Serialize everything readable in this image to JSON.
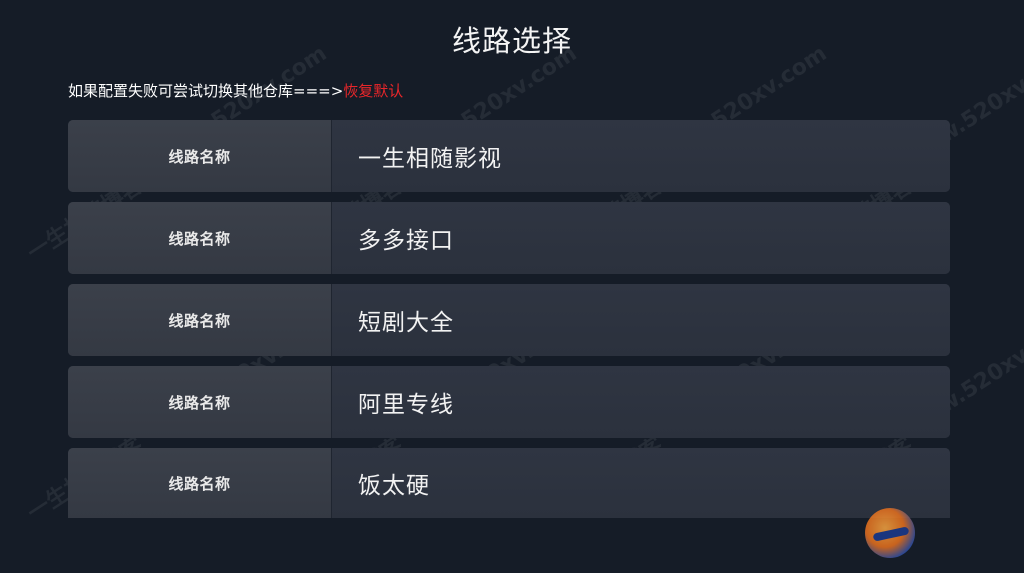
{
  "header": {
    "title": "线路选择"
  },
  "hint": {
    "text": "如果配置失败可尝试切换其他仓库===>",
    "restore_label": "恢复默认"
  },
  "routes": [
    {
      "label": "线路名称",
      "name": "一生相随影视"
    },
    {
      "label": "线路名称",
      "name": "多多接口"
    },
    {
      "label": "线路名称",
      "name": "短剧大全"
    },
    {
      "label": "线路名称",
      "name": "阿里专线"
    },
    {
      "label": "线路名称",
      "name": "饭太硬"
    }
  ],
  "watermark": {
    "site": "www.520xv.com",
    "blog": "一生相随博客"
  }
}
